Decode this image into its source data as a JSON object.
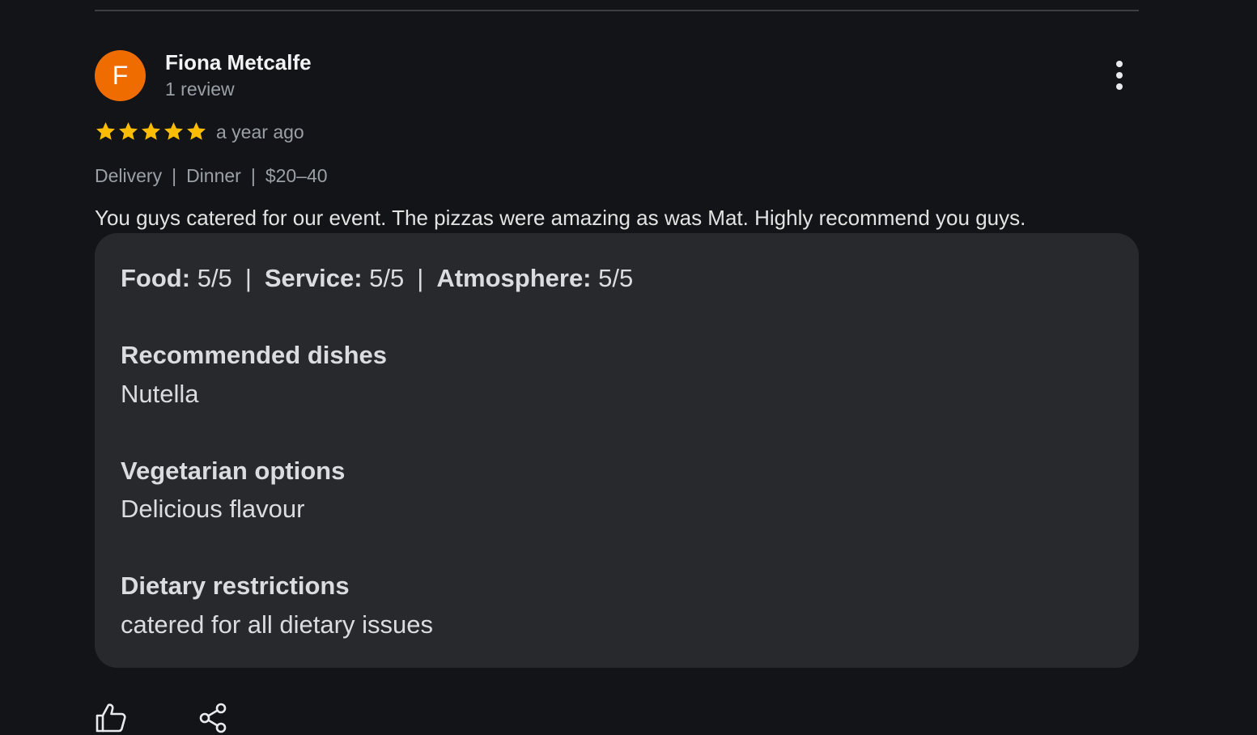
{
  "review": {
    "author": {
      "initial": "F",
      "name": "Fiona Metcalfe",
      "review_count": "1 review",
      "avatar_color": "#ef6c00"
    },
    "rating": 5,
    "rating_max": 5,
    "star_color": "#fbbc04",
    "time": "a year ago",
    "tags": [
      "Delivery",
      "Dinner",
      "$20–40"
    ],
    "text": "You guys catered for our event. The pizzas were amazing as was Mat. Highly recommend you guys.",
    "menu_icon": "more-vert-icon"
  },
  "details": {
    "ratings": [
      {
        "label": "Food:",
        "value": "5/5"
      },
      {
        "label": "Service:",
        "value": "5/5"
      },
      {
        "label": "Atmosphere:",
        "value": "5/5"
      }
    ],
    "sections": [
      {
        "title": "Recommended dishes",
        "value": "Nutella"
      },
      {
        "title": "Vegetarian options",
        "value": "Delicious flavour"
      },
      {
        "title": "Dietary restrictions",
        "value": "catered for all dietary issues"
      }
    ]
  },
  "actions": {
    "like_icon": "thumb-up-icon",
    "share_icon": "share-icon"
  },
  "colors": {
    "background": "#131417",
    "card": "#28292c",
    "muted_text": "#9aa0a6"
  }
}
